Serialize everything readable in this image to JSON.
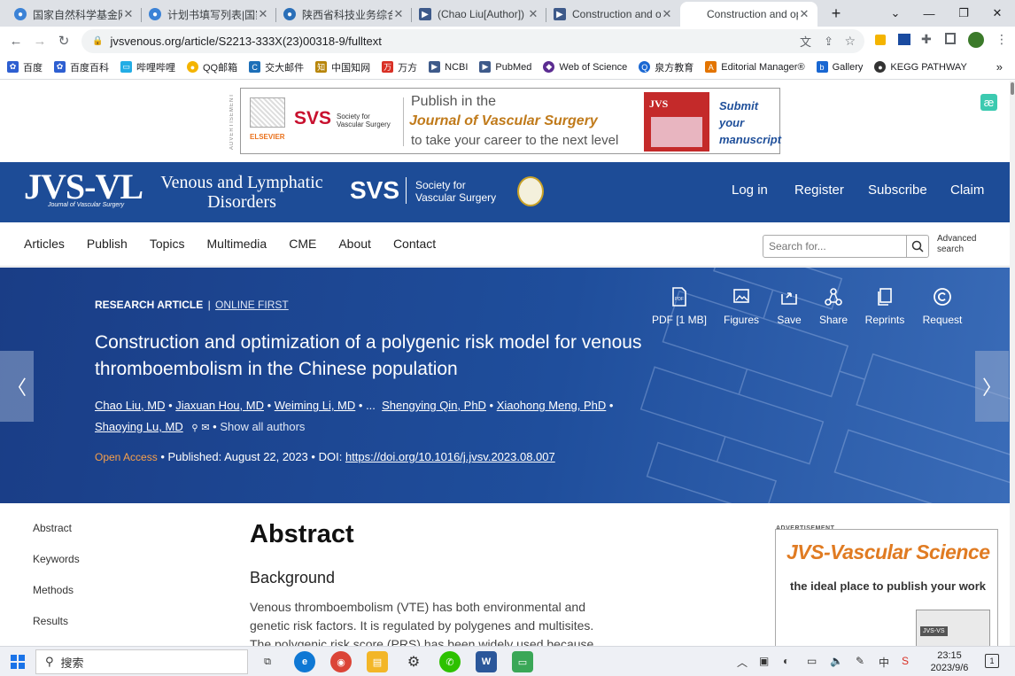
{
  "browser": {
    "tabs": [
      {
        "title": "国家自然科学基金网络",
        "favicon": "#3b82d6"
      },
      {
        "title": "计划书填写列表|国家自",
        "favicon": "#3b82d6"
      },
      {
        "title": "陕西省科技业务综合管",
        "favicon": "#2a6fb8"
      },
      {
        "title": "(Chao Liu[Author]) - ",
        "favicon": "#3e5a8a"
      },
      {
        "title": "Construction and opt",
        "favicon": "#3e5a8a"
      },
      {
        "title": "Construction and opt",
        "favicon": "#ffffff",
        "active": true
      }
    ],
    "new_tab": "+",
    "url": "jvsvenous.org/article/S2213-333X(23)00318-9/fulltext",
    "bookmarks": [
      {
        "label": "百度",
        "color": "#2e5fd1"
      },
      {
        "label": "百度百科",
        "color": "#2e5fd1"
      },
      {
        "label": "哔哩哔哩",
        "color": "#23ade5"
      },
      {
        "label": "QQ邮箱",
        "color": "#f4b400"
      },
      {
        "label": "交大邮件",
        "color": "#1d6fb8"
      },
      {
        "label": "中国知网",
        "color": "#b8860b"
      },
      {
        "label": "万方",
        "color": "#d93025"
      },
      {
        "label": "NCBI",
        "color": "#3e5a8a"
      },
      {
        "label": "PubMed",
        "color": "#3e5a8a"
      },
      {
        "label": "Web of Science",
        "color": "#5b2c91"
      },
      {
        "label": "泉方教育",
        "color": "#1967d2"
      },
      {
        "label": "Editorial Manager®",
        "color": "#e37400"
      },
      {
        "label": "Gallery",
        "color": "#1967d2"
      },
      {
        "label": "KEGG PATHWAY",
        "color": "#333333"
      }
    ],
    "bookmarks_more": "»"
  },
  "top_ad": {
    "vertical_label": "ADVERTISEMENT",
    "publisher": "ELSEVIER",
    "svs": "SVS",
    "svs_name": "Society for Vascular Surgery",
    "line1": "Publish in the",
    "line2": "Journal of Vascular Surgery",
    "line3": "to take your career to the next level",
    "cover_title": "JVS",
    "cta": "Submit your manuscript"
  },
  "header": {
    "logo": "JVS-VL",
    "logo_sub": "Journal of Vascular Surgery",
    "journal_line1": "Venous and Lymphatic",
    "journal_line2": "Disorders",
    "svs": "SVS",
    "svs_line1": "Society for",
    "svs_line2": "Vascular Surgery",
    "links": [
      "Log in",
      "Register",
      "Subscribe",
      "Claim"
    ]
  },
  "nav": {
    "items": [
      "Articles",
      "Publish",
      "Topics",
      "Multimedia",
      "CME",
      "About",
      "Contact"
    ],
    "search_placeholder": "Search for...",
    "advanced_line1": "Advanced",
    "advanced_line2": "search"
  },
  "article": {
    "type": "RESEARCH ARTICLE",
    "divider": "|",
    "status": "ONLINE FIRST",
    "title_line1": "Construction and optimization of a polygenic risk model for venous",
    "title_line2": "thromboembolism in the Chinese population",
    "authors": [
      "Chao Liu, MD",
      "Jiaxuan Hou, MD",
      "Weiming Li, MD",
      "Shengying Qin, PhD",
      "Xiaohong Meng, PhD",
      "Shaoying Lu, MD"
    ],
    "ellipsis": "...",
    "show_all": "Show all authors",
    "open_access": "Open Access",
    "published": "Published: August 22, 2023",
    "doi_label": "DOI:",
    "doi": "https://doi.org/10.1016/j.jvsv.2023.08.007",
    "actions": [
      "PDF [1 MB]",
      "Figures",
      "Save",
      "Share",
      "Reprints",
      "Request"
    ]
  },
  "sidebar": {
    "items": [
      "Abstract",
      "Keywords",
      "Methods",
      "Results"
    ]
  },
  "abstract": {
    "heading": "Abstract",
    "subheading": "Background",
    "lines": [
      "Venous thromboembolism (VTE) has both environmental and",
      "genetic risk factors. It is regulated by polygenes and multisites.",
      "The polygenic risk score (PRS) has been widely used because"
    ]
  },
  "right_ad": {
    "label": "ADVERTISEMENT",
    "title": "JVS-Vascular Science",
    "tagline": "the ideal place to publish your work",
    "cover": "JVS-VS"
  },
  "taskbar": {
    "search": "搜索",
    "time": "23:15",
    "date": "2023/9/6",
    "notif": "1"
  }
}
